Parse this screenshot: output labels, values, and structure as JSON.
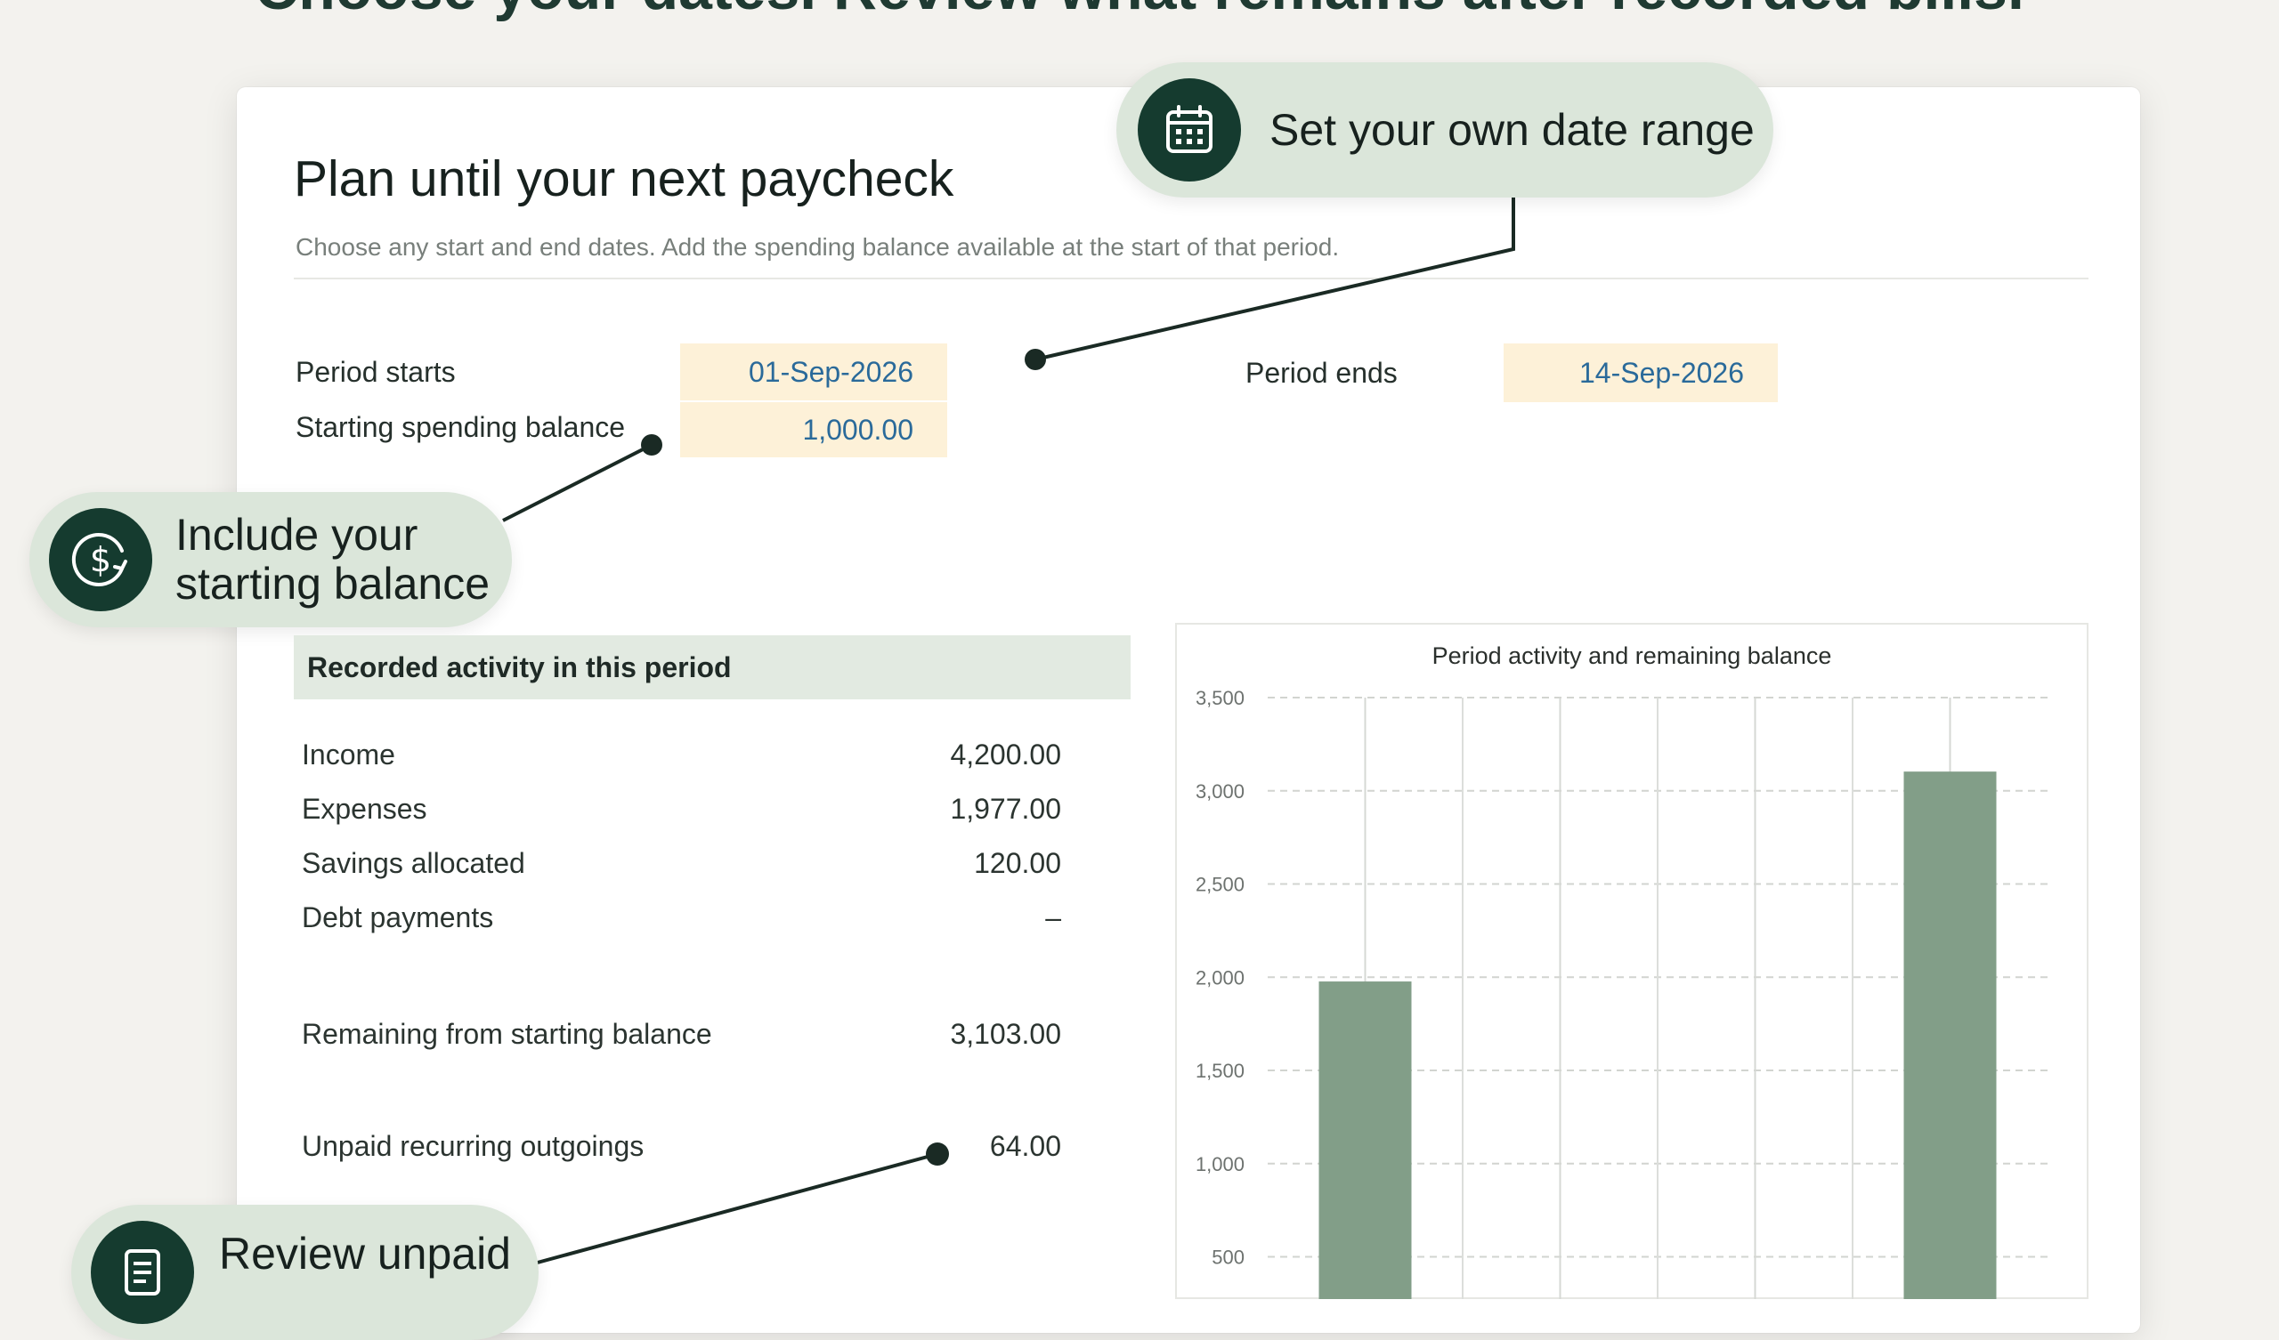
{
  "headline": "Choose your dates. Review what remains after recorded bills.",
  "title": "Plan until your next paycheck",
  "subtitle": "Choose any start and end dates. Add the spending balance available at the start of that period.",
  "fields": {
    "period_starts_label": "Period starts",
    "period_starts_value": "01-Sep-2026",
    "starting_balance_label": "Starting spending balance",
    "starting_balance_value": "1,000.00",
    "period_ends_label": "Period ends",
    "period_ends_value": "14-Sep-2026"
  },
  "callouts": {
    "date_range": "Set your own date range",
    "starting_balance_line1": "Include your",
    "starting_balance_line2": "starting balance",
    "review_unpaid": "Review unpaid"
  },
  "activity": {
    "header": "Recorded activity in this period",
    "rows": [
      {
        "label": "Income",
        "value": "4,200.00"
      },
      {
        "label": "Expenses",
        "value": "1,977.00"
      },
      {
        "label": "Savings allocated",
        "value": "120.00"
      },
      {
        "label": "Debt payments",
        "value": "–"
      }
    ],
    "remaining_label": "Remaining from starting balance",
    "remaining_value": "3,103.00",
    "unpaid_label": "Unpaid recurring outgoings",
    "unpaid_value": "64.00"
  },
  "colors": {
    "accent_dark": "#153b2f",
    "callout_bg": "#dbe6da",
    "input_bg": "#fdf1d8",
    "input_text": "#2a6a9a",
    "bar": "#829e88"
  },
  "icons": {
    "date_range": "calendar-icon",
    "starting_balance": "dollar-icon",
    "review_unpaid": "document-icon"
  },
  "chart_data": {
    "type": "bar",
    "title": "Period activity and remaining balance",
    "xlabel": "",
    "ylabel": "",
    "ylim": [
      0,
      3500
    ],
    "yticks": [
      500,
      1000,
      1500,
      2000,
      2500,
      3000,
      3500
    ],
    "ytick_labels": [
      "500",
      "1,000",
      "1,500",
      "2,000",
      "2,500",
      "3,000",
      "3,500"
    ],
    "categories": [
      "",
      "",
      "",
      ""
    ],
    "values": [
      1977,
      null,
      null,
      3103
    ],
    "grid": true
  }
}
